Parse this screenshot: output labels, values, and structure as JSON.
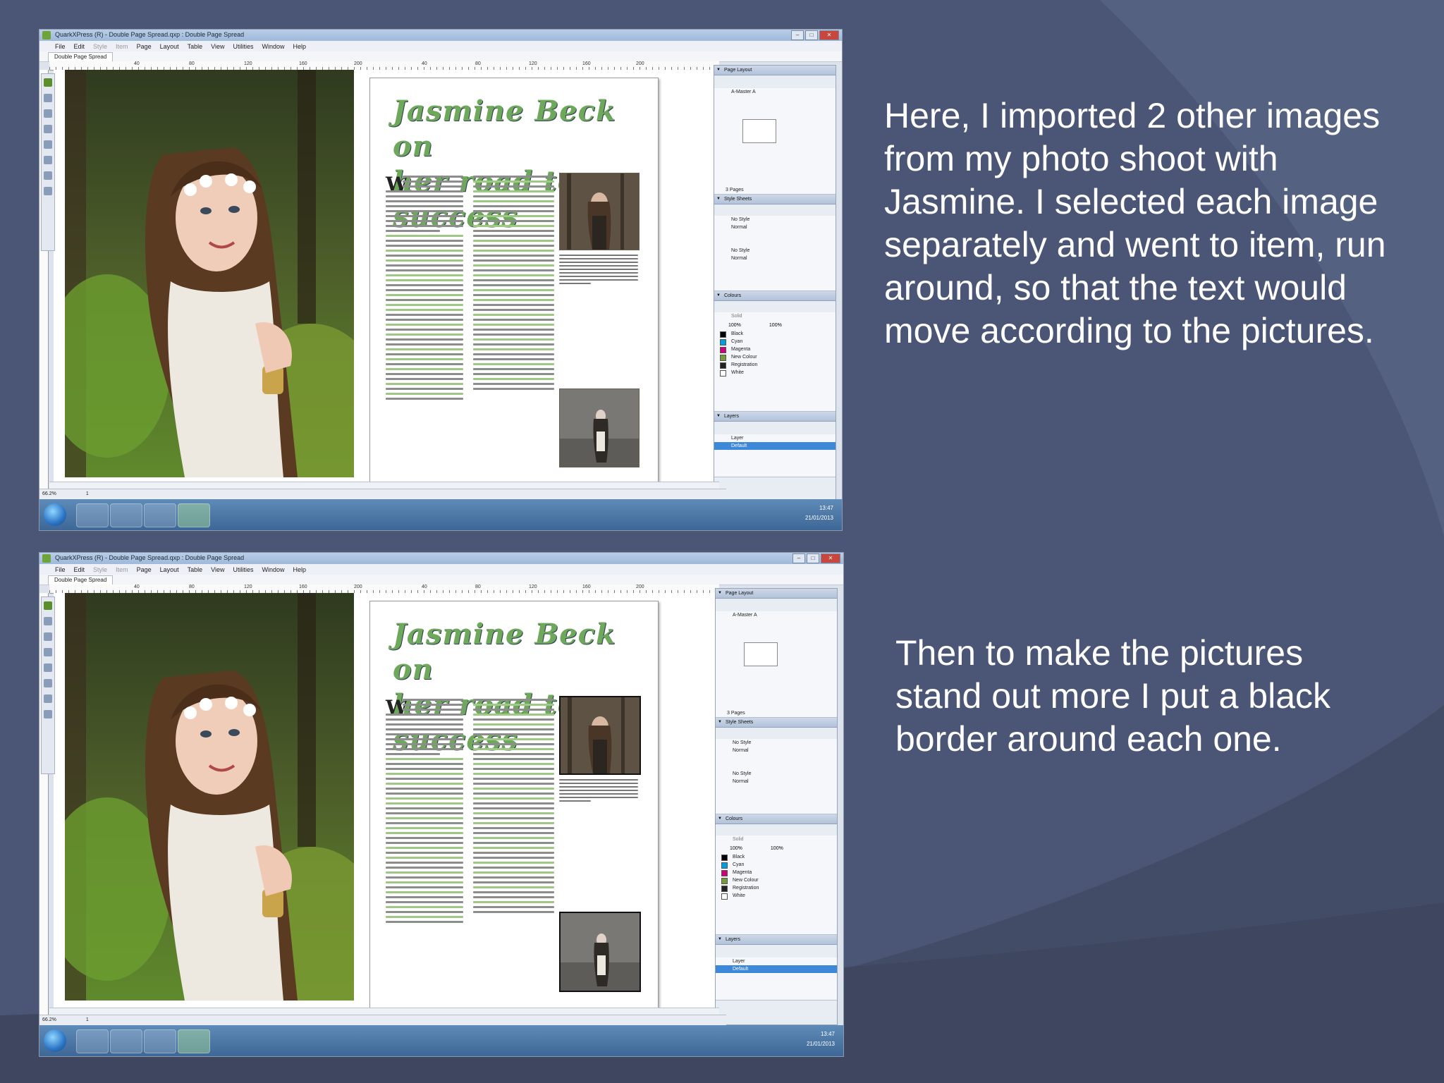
{
  "slide": {
    "caption_top": "Here, I imported 2 other images from my photo shoot with Jasmine. I selected each image separately and went to item, run around, so that the text would move according to the pictures.",
    "caption_bottom": "Then to make the pictures stand out more I put a black border around each one."
  },
  "screens": [
    {
      "window_title": "QuarkXPress (R) - Double Page Spread.qxp : Double Page Spread",
      "menu": [
        "File",
        "Edit",
        "Style",
        "Item",
        "Page",
        "Layout",
        "Table",
        "View",
        "Utilities",
        "Window",
        "Help"
      ],
      "layout_tab": "Double Page Spread",
      "headline_line1": "Jasmine Beck on",
      "headline_line2": "her road to success",
      "dropcap": "W",
      "ruler_labels": [
        "40",
        "80",
        "120",
        "160",
        "200",
        "40",
        "80",
        "120",
        "160",
        "200"
      ],
      "zoom": "66.2%",
      "page_num": "1",
      "panels": {
        "page_layout": "Page Layout",
        "master": "A-Master A",
        "pages_label": "3 Pages",
        "style_sheets": "Style Sheets",
        "no_style": "No Style",
        "normal": "Normal",
        "colours": "Colours",
        "solid": "Solid",
        "opacity1": "100%",
        "opacity2": "100%",
        "colour_items": [
          "Black",
          "Cyan",
          "Magenta",
          "New Colour",
          "Registration",
          "White"
        ],
        "layers": "Layers",
        "layer_header": "Layer",
        "layer_default": "Default"
      },
      "clock_time": "13:47",
      "clock_date": "21/01/2013"
    },
    {
      "window_title": "QuarkXPress (R) - Double Page Spread.qxp : Double Page Spread",
      "menu": [
        "File",
        "Edit",
        "Style",
        "Item",
        "Page",
        "Layout",
        "Table",
        "View",
        "Utilities",
        "Window",
        "Help"
      ],
      "layout_tab": "Double Page Spread",
      "headline_line1": "Jasmine Beck on",
      "headline_line2": "her road to success",
      "dropcap": "W",
      "ruler_labels": [
        "40",
        "80",
        "120",
        "160",
        "200",
        "40",
        "80",
        "120",
        "160",
        "200"
      ],
      "zoom": "66.2%",
      "page_num": "1",
      "panels": {
        "page_layout": "Page Layout",
        "master": "A-Master A",
        "pages_label": "3 Pages",
        "style_sheets": "Style Sheets",
        "no_style": "No Style",
        "normal": "Normal",
        "colours": "Colours",
        "solid": "Solid",
        "opacity1": "100%",
        "opacity2": "100%",
        "colour_items": [
          "Black",
          "Cyan",
          "Magenta",
          "New Colour",
          "Registration",
          "White"
        ],
        "layers": "Layers",
        "layer_header": "Layer",
        "layer_default": "Default"
      },
      "clock_time": "13:47",
      "clock_date": "21/01/2013"
    }
  ],
  "colors": {
    "background": "#4b5676",
    "headline": "#6da85b",
    "green_text": "#9fc887",
    "swatches": [
      "#000000",
      "#00a0e0",
      "#d0007a",
      "#7a9a3a",
      "#222222",
      "#ffffff"
    ]
  }
}
